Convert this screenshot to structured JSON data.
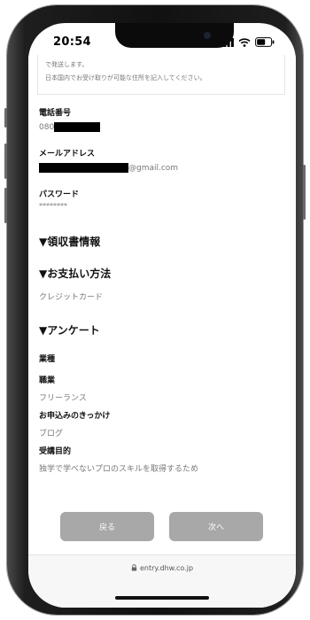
{
  "status_bar": {
    "time": "20:54"
  },
  "notice": {
    "line1": "で発送します。",
    "line2": "日本国内でお受け取りが可能な住所を記入してください。"
  },
  "phone": {
    "label": "電話番号",
    "value_prefix": "080"
  },
  "email": {
    "label": "メールアドレス",
    "value_suffix": "@gmail.com"
  },
  "password": {
    "label": "パスワード",
    "value": "********"
  },
  "sections": {
    "receipt": "▼領収書情報",
    "payment": "▼お支払い方法",
    "survey": "▼アンケート"
  },
  "payment": {
    "method": "クレジットカード"
  },
  "survey": {
    "industry_label": "業種",
    "occupation_label": "職業",
    "occupation_value": "フリーランス",
    "trigger_label": "お申込みのきっかけ",
    "trigger_value": "ブログ",
    "purpose_label": "受講目的",
    "purpose_value": "独学で学べないプロのスキルを取得するため"
  },
  "buttons": {
    "back": "戻る",
    "next": "次へ"
  },
  "browser": {
    "url": "entry.dhw.co.jp"
  },
  "colors": {
    "button_bg": "#a8a8a8",
    "label_text": "#111111",
    "value_text": "#777777"
  }
}
